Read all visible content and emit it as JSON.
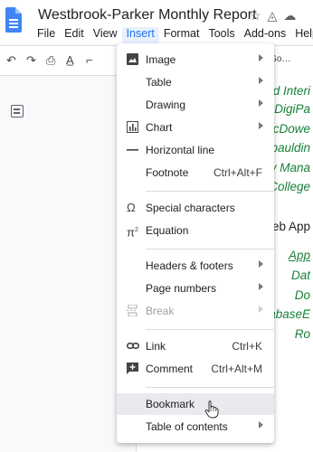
{
  "app": {
    "title": "Westbrook-Parker Monthly Report",
    "icons": [
      "star-icon",
      "move-icon",
      "cloud-status-icon"
    ]
  },
  "menubar": [
    "File",
    "Edit",
    "View",
    "Insert",
    "Format",
    "Tools",
    "Add-ons",
    "Help"
  ],
  "toolbar": {
    "font": "ry Go…"
  },
  "insert_menu": [
    {
      "label": "Image",
      "icon": "image-icon",
      "arrow": true
    },
    {
      "label": "Table",
      "arrow": true
    },
    {
      "label": "Drawing",
      "arrow": true
    },
    {
      "label": "Chart",
      "icon": "chart-icon",
      "arrow": true
    },
    {
      "label": "Horizontal line",
      "icon": "horizontal-line-icon"
    },
    {
      "label": "Footnote",
      "shortcut": "Ctrl+Alt+F"
    },
    {
      "label": "Special characters",
      "icon": "omega-icon"
    },
    {
      "label": "Equation",
      "icon": "pi-icon"
    },
    {
      "label": "Headers & footers",
      "arrow": true
    },
    {
      "label": "Page numbers",
      "arrow": true
    },
    {
      "label": "Break",
      "icon": "break-icon",
      "arrow": true,
      "disabled": true
    },
    {
      "label": "Link",
      "icon": "link-icon",
      "shortcut": "Ctrl+K"
    },
    {
      "label": "Comment",
      "icon": "comment-icon",
      "shortcut": "Ctrl+Alt+M"
    },
    {
      "label": "Bookmark",
      "hover": true
    },
    {
      "label": "Table of contents",
      "arrow": true
    }
  ],
  "document": {
    "lines": [
      "nd Interi",
      "DigiPa",
      "McDowe",
      "Spauldin",
      "ry Mana",
      "College",
      "Web App",
      "App",
      "Dat",
      "Do",
      "DatabaseE",
      "Ro"
    ]
  },
  "colors": {
    "accent": "#1a73e8",
    "doc_green": "#188038"
  }
}
